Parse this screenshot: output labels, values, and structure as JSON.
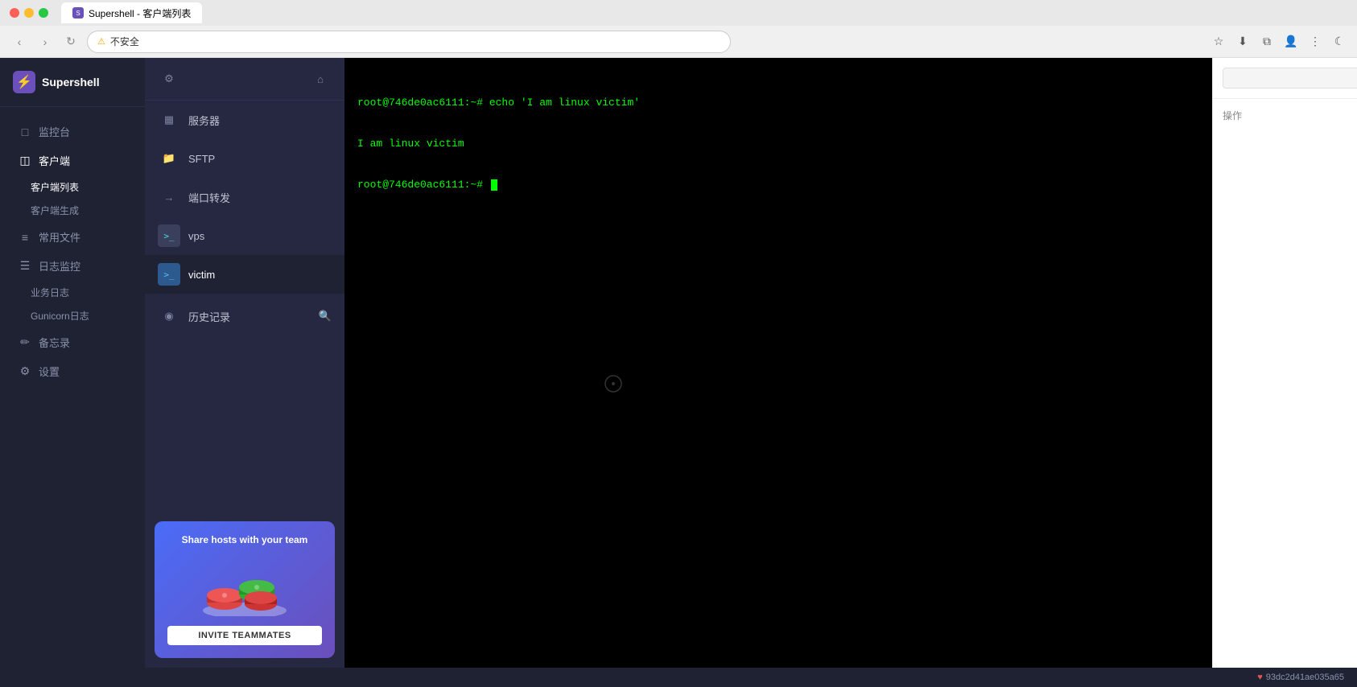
{
  "browser": {
    "tab_label": "Supershell - 客户端列表",
    "url": "不安全",
    "url_full": "不安全"
  },
  "app": {
    "logo": "⚡",
    "name": "Supershell"
  },
  "main_nav": {
    "items": [
      {
        "id": "monitor",
        "icon": "□",
        "label": "监控台"
      },
      {
        "id": "clients",
        "icon": "◫",
        "label": "客户端",
        "active": true
      },
      {
        "id": "files",
        "icon": "≡",
        "label": "常用文件"
      },
      {
        "id": "logs",
        "icon": "☰",
        "label": "日志监控"
      },
      {
        "id": "notes",
        "icon": "✏",
        "label": "备忘录"
      },
      {
        "id": "settings",
        "icon": "⚙",
        "label": "设置"
      }
    ],
    "sub_items": {
      "clients": [
        "客户端列表",
        "客户端生成"
      ],
      "logs": [
        "业务日志",
        "Gunicorn日志"
      ]
    }
  },
  "context_sidebar": {
    "items": [
      {
        "id": "settings",
        "icon": "⚙",
        "label": "设置",
        "type": "icon"
      },
      {
        "id": "servers",
        "icon": "▦",
        "label": "服务器",
        "type": "icon"
      },
      {
        "id": "sftp",
        "icon": "📁",
        "label": "SFTP",
        "type": "icon"
      },
      {
        "id": "port-forward",
        "icon": "→",
        "label": "端口转发",
        "type": "icon"
      },
      {
        "id": "vps",
        "icon": ">_",
        "label": "vps",
        "type": "terminal"
      },
      {
        "id": "victim",
        "icon": ">_",
        "label": "victim",
        "type": "terminal",
        "active": true
      }
    ],
    "history": {
      "icon": "◉",
      "label": "历史记录",
      "search_icon": "🔍"
    }
  },
  "terminal": {
    "lines": [
      "root@746de0ac6111:~# echo 'I am linux victim'",
      "I am linux victim",
      "root@746de0ac6111:~# "
    ]
  },
  "right_panel": {
    "search_placeholder": "",
    "actions_label": "操作"
  },
  "status_bar": {
    "hash": "93dc2d41ae035a65"
  },
  "invite_card": {
    "title": "Share hosts with your team",
    "button_label": "INVITE TEAMMATES"
  }
}
